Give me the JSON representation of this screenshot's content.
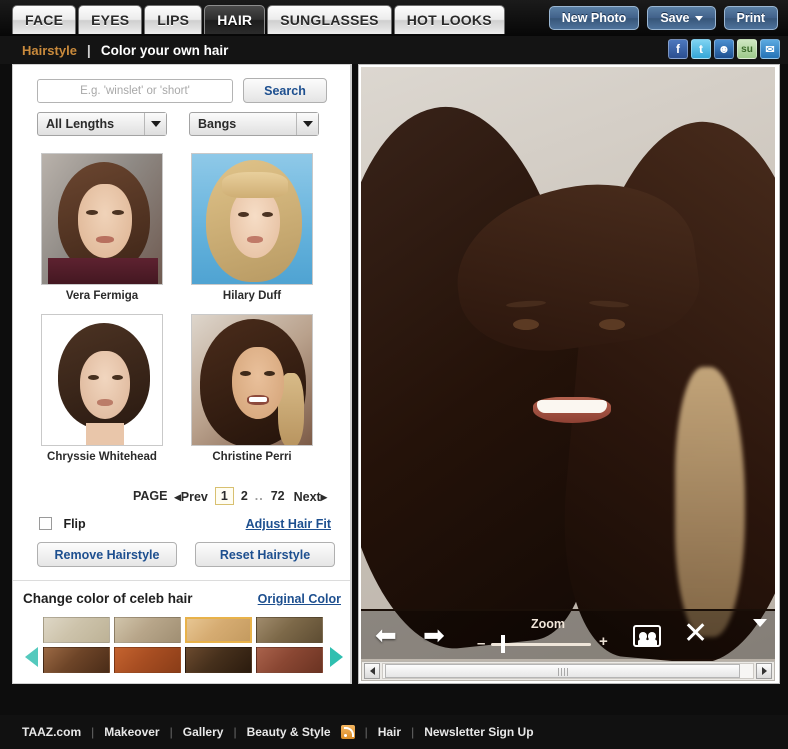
{
  "topbar": {
    "tabs": [
      {
        "label": "FACE",
        "active": false
      },
      {
        "label": "EYES",
        "active": false
      },
      {
        "label": "LIPS",
        "active": false
      },
      {
        "label": "HAIR",
        "active": true
      },
      {
        "label": "SUNGLASSES",
        "active": false
      },
      {
        "label": "HOT LOOKS",
        "active": false
      }
    ],
    "new_photo": "New Photo",
    "save": "Save",
    "print": "Print"
  },
  "subnav": {
    "crumb": "Hairstyle",
    "separator": "|",
    "title": "Color your own hair",
    "social": [
      {
        "name": "facebook-icon",
        "glyph": "f"
      },
      {
        "name": "twitter-icon",
        "glyph": "t"
      },
      {
        "name": "myspace-icon",
        "glyph": "\u0001"
      },
      {
        "name": "stumbleupon-icon",
        "glyph": "SU"
      },
      {
        "name": "email-icon",
        "glyph": "✉"
      }
    ]
  },
  "search": {
    "placeholder": "E.g. 'winslet' or 'short'",
    "value": "",
    "button": "Search"
  },
  "filters": [
    {
      "name": "length-select",
      "value": "All Lengths"
    },
    {
      "name": "bangs-select",
      "value": "Bangs"
    }
  ],
  "styles": [
    {
      "name": "Vera Fermiga",
      "art": "a"
    },
    {
      "name": "Hilary Duff",
      "art": "b"
    },
    {
      "name": "Chryssie Whitehead",
      "art": "c"
    },
    {
      "name": "Christine Perri",
      "art": "d"
    }
  ],
  "pagination": {
    "label": "PAGE",
    "prev": "◂Prev",
    "pages": [
      "1",
      "2"
    ],
    "current": "1",
    "dots": "..",
    "last": "72",
    "next": "Next▸"
  },
  "controls": {
    "flip_label": "Flip",
    "flip_checked": false,
    "adjust_link": "Adjust Hair Fit",
    "remove_button": "Remove Hairstyle",
    "reset_button": "Reset Hairstyle"
  },
  "color_section": {
    "title": "Change color of celeb hair",
    "original_link": "Original Color",
    "swatches_row1": [
      "#cfc4ae",
      "#c3b295",
      "#dcb77e",
      "#9a8062"
    ],
    "swatches_row2": [
      "#8a5b3b",
      "#b0552a",
      "#6b destroyed",
      "#9b5a46"
    ],
    "swatch_rows": [
      [
        "#cfc4ae",
        "#c3b295",
        "#dcb77e",
        "#9a8062"
      ],
      [
        "#8a5b3b",
        "#b0552a",
        "#5b3a24",
        "#9b5a46"
      ]
    ],
    "selected_index": 2,
    "prev_arrow": "left-arrow-icon",
    "next_arrow": "right-arrow-icon"
  },
  "preview": {
    "toolbar": {
      "back": "⬅",
      "forward": "➡",
      "zoom_label": "Zoom",
      "zoom_minus": "–",
      "zoom_plus": "+",
      "zoom_value": 10,
      "compare_icon": "people-icon",
      "close_icon": "close-icon",
      "collapse_icon": "chevron-down-icon"
    }
  },
  "footer": {
    "links": [
      {
        "label": "TAAZ.com",
        "rss": false
      },
      {
        "label": "Makeover",
        "rss": false
      },
      {
        "label": "Gallery",
        "rss": false
      },
      {
        "label": "Beauty & Style",
        "rss": true
      },
      {
        "label": "Hair",
        "rss": false
      },
      {
        "label": "Newsletter Sign Up",
        "rss": false
      }
    ],
    "separator": "|"
  }
}
